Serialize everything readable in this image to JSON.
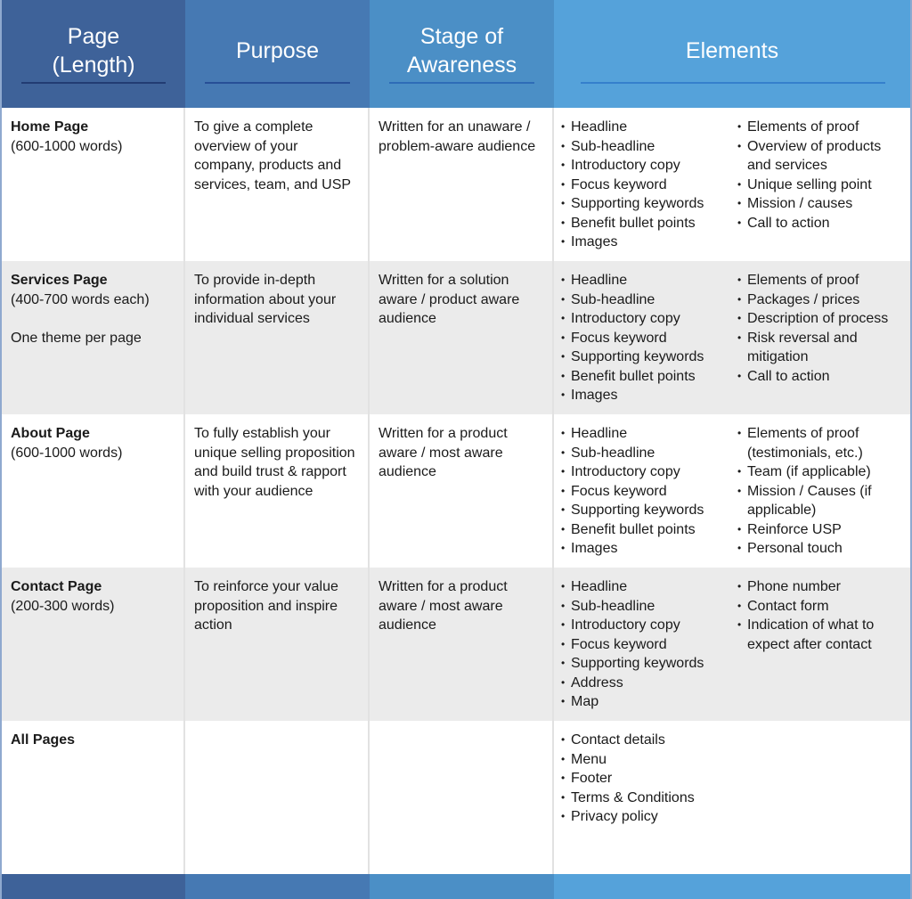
{
  "header": {
    "columns": [
      {
        "label_line1": "Page",
        "label_line2": "(Length)"
      },
      {
        "label_line1": "Purpose",
        "label_line2": ""
      },
      {
        "label_line1": "Stage of",
        "label_line2": "Awareness"
      },
      {
        "label_line1": "Elements",
        "label_line2": ""
      }
    ]
  },
  "colors": {
    "col1": "#3e6299",
    "col2": "#4679b3",
    "col3": "#4b8fc6",
    "col4": "#55a2da",
    "row_alt": "#ebebeb"
  },
  "rows": [
    {
      "page": "Home Page",
      "length": "(600-1000 words)",
      "note": "",
      "purpose": "To give a complete overview of your company, products and services, team, and USP",
      "awareness": "Written for an unaware / problem-aware audience",
      "elements_left": [
        "Headline",
        "Sub-headline",
        "Introductory copy",
        "Focus keyword",
        "Supporting keywords",
        "Benefit bullet points",
        "Images"
      ],
      "elements_right": [
        "Elements of proof",
        "Overview of products and services",
        "Unique selling point",
        "Mission / causes",
        "Call to action"
      ]
    },
    {
      "page": "Services Page",
      "length": "(400-700 words each)",
      "note": "One theme per page",
      "purpose": "To provide in-depth information about your individual services",
      "awareness": "Written for a solution aware / product aware audience",
      "elements_left": [
        "Headline",
        "Sub-headline",
        "Introductory copy",
        "Focus keyword",
        "Supporting keywords",
        "Benefit bullet points",
        "Images"
      ],
      "elements_right": [
        "Elements of proof",
        "Packages / prices",
        "Description of process",
        "Risk reversal and mitigation",
        "Call to action"
      ]
    },
    {
      "page": "About Page",
      "length": "(600-1000 words)",
      "note": "",
      "purpose": "To fully establish your unique selling proposition and build trust & rapport with your audience",
      "awareness": "Written for a product aware / most aware audience",
      "elements_left": [
        "Headline",
        "Sub-headline",
        "Introductory copy",
        "Focus keyword",
        "Supporting keywords",
        "Benefit bullet points",
        "Images"
      ],
      "elements_right": [
        "Elements of proof (testimonials, etc.)",
        "Team (if applicable)",
        "Mission / Causes (if applicable)",
        "Reinforce USP",
        "Personal touch"
      ]
    },
    {
      "page": "Contact Page",
      "length": "(200-300 words)",
      "note": "",
      "purpose": "To reinforce your value proposition and inspire action",
      "awareness": "Written for a product aware / most aware audience",
      "elements_left": [
        "Headline",
        "Sub-headline",
        "Introductory copy",
        "Focus keyword",
        "Supporting keywords",
        "Address",
        "Map"
      ],
      "elements_right": [
        "Phone number",
        "Contact form",
        "Indication of what to expect after contact"
      ]
    },
    {
      "page": "All Pages",
      "length": "",
      "note": "",
      "purpose": "",
      "awareness": "",
      "elements_left": [
        "Contact details",
        "Menu",
        "Footer",
        "Terms & Conditions",
        "Privacy policy"
      ],
      "elements_right": []
    }
  ]
}
